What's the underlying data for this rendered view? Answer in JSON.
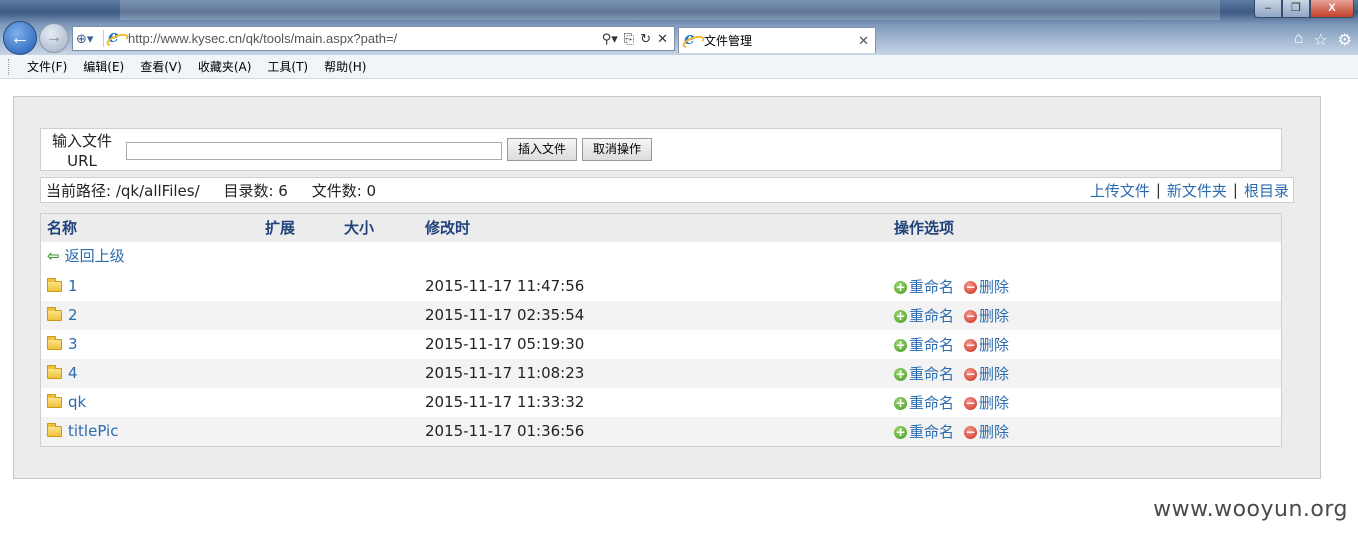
{
  "browser": {
    "address_url": "http://www.kysec.cn/qk/tools/main.aspx?path=/",
    "tab_title": "文件管理",
    "window_buttons": [
      "–",
      "❐",
      "X"
    ],
    "icons": {
      "back": "back-arrow-icon",
      "forward": "forward-arrow-icon",
      "home": "home-icon",
      "favorites": "star-icon",
      "tools": "gear-icon"
    }
  },
  "menubar": {
    "items": [
      "文件(F)",
      "编辑(E)",
      "查看(V)",
      "收藏夹(A)",
      "工具(T)",
      "帮助(H)"
    ]
  },
  "upload": {
    "label": "输入文件URL",
    "input_value": "",
    "insert_button": "插入文件",
    "cancel_button": "取消操作"
  },
  "path_bar": {
    "current_path": "当前路径: /qk/allFiles/",
    "dir_count": "目录数: 6",
    "file_count": "文件数: 0",
    "actions": [
      "上传文件",
      "新文件夹",
      "根目录"
    ]
  },
  "table": {
    "headers": {
      "name": "名称",
      "ext": "扩展",
      "size": "大小",
      "modified": "修改时",
      "ops": "操作选项"
    },
    "parent_link": "返回上级",
    "rename_label": "重命名",
    "delete_label": "删除",
    "rows": [
      {
        "name": "1",
        "modified": "2015-11-17 11:47:56"
      },
      {
        "name": "2",
        "modified": "2015-11-17 02:35:54"
      },
      {
        "name": "3",
        "modified": "2015-11-17 05:19:30"
      },
      {
        "name": "4",
        "modified": "2015-11-17 11:08:23"
      },
      {
        "name": "qk",
        "modified": "2015-11-17 11:33:32"
      },
      {
        "name": "titlePic",
        "modified": "2015-11-17 01:36:56"
      }
    ]
  },
  "watermark": "www.wooyun.org",
  "colors": {
    "link": "#2b6cb0",
    "header_text": "#22437c",
    "panel_bg": "#ececec"
  }
}
